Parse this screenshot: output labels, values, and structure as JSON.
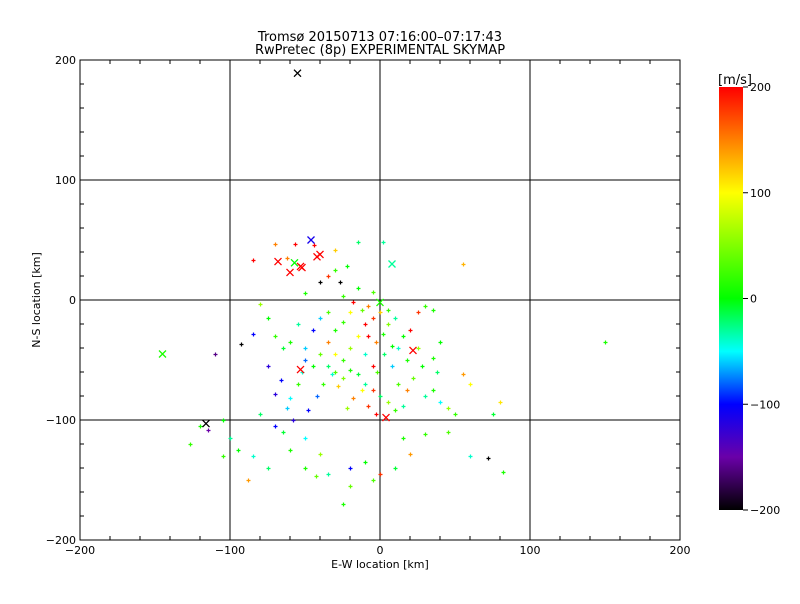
{
  "chart_data": {
    "type": "scatter",
    "title": "Tromsø 20150713 07:16:00–07:17:43",
    "subtitle": "RwPretec (8p) EXPERIMENTAL SKYMAP",
    "xlabel": "E-W location [km]",
    "ylabel": "N-S location [km]",
    "xlim": [
      -200,
      200
    ],
    "ylim": [
      -200,
      200
    ],
    "xticks": [
      -200,
      -100,
      0,
      100,
      200
    ],
    "yticks": [
      -200,
      -100,
      0,
      100,
      200
    ],
    "xtick_labels": [
      "−200",
      "−100",
      "0",
      "100",
      "200"
    ],
    "ytick_labels": [
      "−200",
      "−100",
      "0",
      "100",
      "200"
    ],
    "grid": true,
    "colorbar": {
      "label": "[m/s]",
      "range": [
        -200,
        200
      ],
      "ticks": [
        200,
        100,
        0,
        -100,
        -200
      ],
      "tick_labels": [
        "200",
        "100",
        "0",
        "−100",
        "−200"
      ]
    },
    "crosses": [
      [
        -55,
        189,
        -200
      ],
      [
        -46,
        50,
        -110
      ],
      [
        -68,
        32,
        200
      ],
      [
        -60,
        23,
        200
      ],
      [
        -53,
        28,
        200
      ],
      [
        -42,
        36,
        200
      ],
      [
        -40,
        38,
        200
      ],
      [
        -52,
        27,
        200
      ],
      [
        -57,
        31,
        0
      ],
      [
        8,
        30,
        -30
      ],
      [
        0,
        -2,
        10
      ],
      [
        -145,
        -45,
        10
      ],
      [
        22,
        -42,
        200
      ],
      [
        -53,
        -58,
        200
      ],
      [
        -116,
        -103,
        -200
      ],
      [
        4,
        -98,
        200
      ]
    ],
    "points": [
      [
        -70,
        47,
        150
      ],
      [
        -57,
        47,
        200
      ],
      [
        -44,
        46,
        200
      ],
      [
        -15,
        48,
        -20
      ],
      [
        2,
        48,
        -30
      ],
      [
        -30,
        42,
        120
      ],
      [
        -85,
        33,
        200
      ],
      [
        -62,
        35,
        150
      ],
      [
        -22,
        28,
        0
      ],
      [
        -30,
        25,
        20
      ],
      [
        -35,
        20,
        180
      ],
      [
        -27,
        15,
        -200
      ],
      [
        -40,
        15,
        -200
      ],
      [
        -15,
        10,
        0
      ],
      [
        -5,
        7,
        30
      ],
      [
        -50,
        6,
        10
      ],
      [
        -25,
        3,
        20
      ],
      [
        -18,
        -2,
        200
      ],
      [
        -8,
        -5,
        150
      ],
      [
        5,
        -8,
        20
      ],
      [
        35,
        -8,
        10
      ],
      [
        55,
        30,
        130
      ],
      [
        -80,
        -3,
        60
      ],
      [
        -110,
        -45,
        -160
      ],
      [
        -120,
        -105,
        10
      ],
      [
        -127,
        -120,
        20
      ],
      [
        -115,
        -108,
        -150
      ],
      [
        -93,
        -37,
        -200
      ],
      [
        -85,
        -28,
        -100
      ],
      [
        -75,
        -55,
        -120
      ],
      [
        -70,
        -78,
        -120
      ],
      [
        -60,
        -82,
        -50
      ],
      [
        -50,
        -50,
        -80
      ],
      [
        -45,
        -25,
        -100
      ],
      [
        -40,
        -15,
        -60
      ],
      [
        -35,
        -35,
        150
      ],
      [
        -30,
        -45,
        100
      ],
      [
        -25,
        -50,
        20
      ],
      [
        -20,
        -40,
        60
      ],
      [
        -15,
        -30,
        100
      ],
      [
        -10,
        -20,
        200
      ],
      [
        -5,
        -15,
        180
      ],
      [
        0,
        -10,
        120
      ],
      [
        5,
        -20,
        50
      ],
      [
        10,
        -15,
        -30
      ],
      [
        15,
        -30,
        0
      ],
      [
        20,
        -25,
        200
      ],
      [
        25,
        -10,
        180
      ],
      [
        30,
        -5,
        20
      ],
      [
        40,
        -35,
        0
      ],
      [
        -10,
        -45,
        -40
      ],
      [
        -5,
        -55,
        200
      ],
      [
        -2,
        -60,
        30
      ],
      [
        3,
        -45,
        -20
      ],
      [
        8,
        -55,
        -60
      ],
      [
        12,
        -70,
        30
      ],
      [
        18,
        -75,
        150
      ],
      [
        22,
        -65,
        40
      ],
      [
        30,
        -80,
        -30
      ],
      [
        35,
        -75,
        10
      ],
      [
        40,
        -85,
        -50
      ],
      [
        45,
        -90,
        60
      ],
      [
        50,
        -95,
        20
      ],
      [
        55,
        -62,
        140
      ],
      [
        60,
        -70,
        100
      ],
      [
        75,
        -95,
        -10
      ],
      [
        80,
        -85,
        110
      ],
      [
        150,
        -35,
        10
      ],
      [
        60,
        -130,
        -40
      ],
      [
        72,
        -132,
        -200
      ],
      [
        82,
        -143,
        10
      ],
      [
        45,
        -110,
        30
      ],
      [
        30,
        -112,
        20
      ],
      [
        20,
        -128,
        140
      ],
      [
        10,
        -140,
        -10
      ],
      [
        0,
        -145,
        180
      ],
      [
        -10,
        -135,
        0
      ],
      [
        -20,
        -140,
        -100
      ],
      [
        -35,
        -145,
        -30
      ],
      [
        -40,
        -128,
        60
      ],
      [
        -50,
        -115,
        -50
      ],
      [
        -60,
        -125,
        10
      ],
      [
        -65,
        -110,
        -10
      ],
      [
        -70,
        -105,
        -100
      ],
      [
        -80,
        -95,
        -20
      ],
      [
        -85,
        -130,
        -40
      ],
      [
        -88,
        -150,
        140
      ],
      [
        -100,
        -115,
        -30
      ],
      [
        -105,
        -100,
        0
      ],
      [
        -25,
        -170,
        10
      ],
      [
        -20,
        -155,
        40
      ],
      [
        -5,
        -150,
        30
      ],
      [
        15,
        -115,
        10
      ],
      [
        -3,
        -95,
        200
      ],
      [
        -8,
        -88,
        180
      ],
      [
        -12,
        -75,
        100
      ],
      [
        -18,
        -82,
        150
      ],
      [
        -22,
        -90,
        60
      ],
      [
        -28,
        -72,
        120
      ],
      [
        -32,
        -62,
        -40
      ],
      [
        -38,
        -70,
        20
      ],
      [
        -42,
        -80,
        -80
      ],
      [
        -48,
        -92,
        -100
      ],
      [
        -52,
        -60,
        -40
      ],
      [
        -55,
        -70,
        20
      ],
      [
        -58,
        -100,
        -120
      ],
      [
        -62,
        -90,
        -60
      ],
      [
        -66,
        -67,
        -100
      ],
      [
        -50,
        -40,
        -60
      ],
      [
        -45,
        -55,
        0
      ],
      [
        -40,
        -45,
        40
      ],
      [
        -35,
        -55,
        -20
      ],
      [
        -30,
        -60,
        30
      ],
      [
        -25,
        -65,
        50
      ],
      [
        -20,
        -58,
        10
      ],
      [
        -15,
        -62,
        -10
      ],
      [
        -10,
        -70,
        -30
      ],
      [
        -5,
        -75,
        180
      ],
      [
        0,
        -80,
        -20
      ],
      [
        5,
        -85,
        60
      ],
      [
        10,
        -92,
        20
      ],
      [
        15,
        -88,
        -30
      ],
      [
        -55,
        -20,
        -30
      ],
      [
        -60,
        -35,
        10
      ],
      [
        -65,
        -40,
        -10
      ],
      [
        -70,
        -30,
        20
      ],
      [
        -75,
        -15,
        0
      ],
      [
        -20,
        -10,
        100
      ],
      [
        -12,
        -8,
        40
      ],
      [
        -25,
        -18,
        20
      ],
      [
        -30,
        -25,
        10
      ],
      [
        -35,
        -10,
        30
      ],
      [
        -8,
        -30,
        200
      ],
      [
        -3,
        -35,
        150
      ],
      [
        2,
        -28,
        10
      ],
      [
        8,
        -38,
        0
      ],
      [
        12,
        -40,
        -40
      ],
      [
        18,
        -50,
        10
      ],
      [
        25,
        -40,
        60
      ],
      [
        28,
        -55,
        0
      ],
      [
        35,
        -48,
        10
      ],
      [
        38,
        -60,
        -20
      ],
      [
        -50,
        -140,
        10
      ],
      [
        -43,
        -147,
        40
      ],
      [
        -75,
        -140,
        -20
      ],
      [
        -95,
        -125,
        0
      ],
      [
        -105,
        -130,
        20
      ]
    ]
  }
}
